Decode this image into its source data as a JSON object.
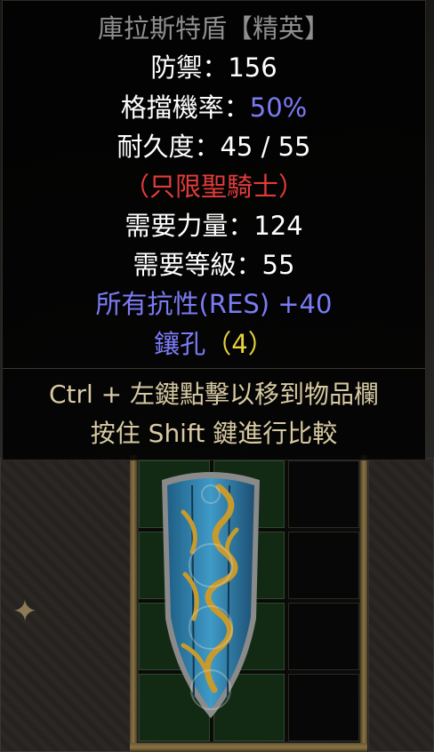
{
  "tooltip": {
    "item_name": "庫拉斯特盾【精英】",
    "defense": "防禦：156",
    "block_label": "格擋機率：",
    "block_value": "50%",
    "durability": "耐久度：45 / 55",
    "class_only": "（只限聖騎士）",
    "required_strength": "需要力量：124",
    "required_level": "需要等級：55",
    "all_resist": "所有抗性(RES) +40",
    "sockets_label": "鑲孔",
    "sockets_value": "（4）",
    "hint_ctrl": "Ctrl + 左鍵點擊以移到物品欄",
    "hint_shift": "按住 Shift 鍵進行比較"
  },
  "inventory": {
    "columns": 3,
    "rows": 4,
    "item": "shield"
  },
  "colors": {
    "name_gray": "#8f8f8f",
    "magic_blue": "#7b7bf5",
    "red_requirement": "#e23b3b",
    "socket_yellow": "#e8d23c",
    "hint_tan": "#d7c9a2"
  }
}
